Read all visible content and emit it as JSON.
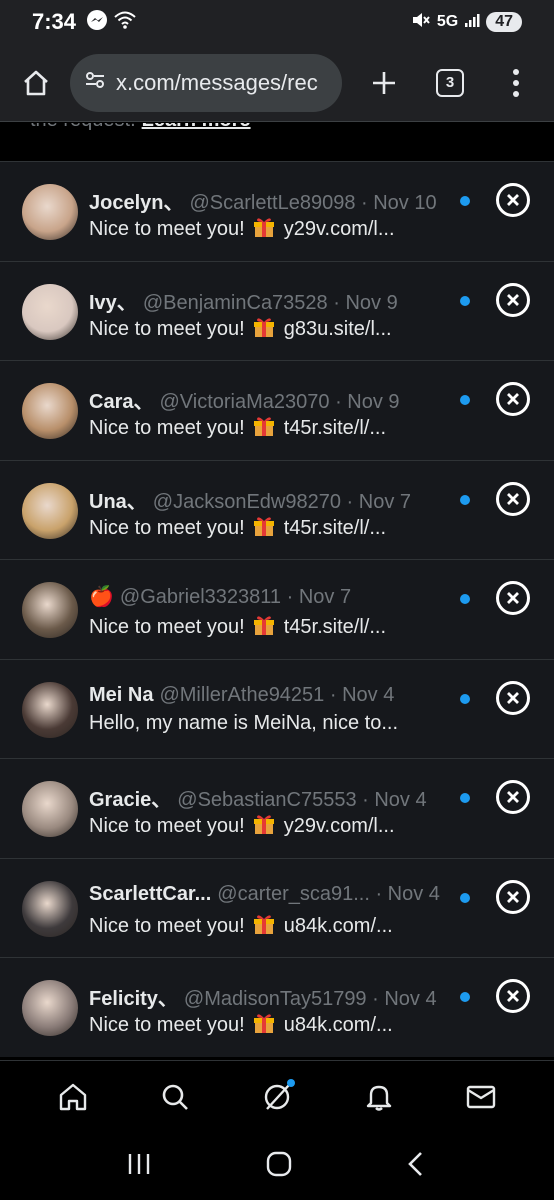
{
  "status_bar": {
    "time": "7:34",
    "network": "5G",
    "battery": "47"
  },
  "browser": {
    "url": "x.com/messages/rec",
    "tab_count": "3"
  },
  "notice": {
    "text": "the request.",
    "link": "Learn more"
  },
  "messages": [
    {
      "name": "Jocelyn、",
      "handle": "@ScarlettLe89098 · Nov 10",
      "preview": "Nice to meet you!",
      "link": "y29v.com/l...",
      "has_gift": true,
      "avatar_color": "#c8a48a"
    },
    {
      "name": "Ivy、",
      "handle": "@BenjaminCa73528 · Nov 9",
      "preview": "Nice to meet you!",
      "link": "g83u.site/l...",
      "has_gift": true,
      "avatar_color": "#d9c8c0"
    },
    {
      "name": "Cara、",
      "handle": "@VictoriaMa23070 · Nov 9",
      "preview": "Nice to meet you!",
      "link": "t45r.site/l/...",
      "has_gift": true,
      "avatar_color": "#b88f6a"
    },
    {
      "name": "Una、",
      "handle": "@JacksonEdw98270 · Nov 7",
      "preview": "Nice to meet you!",
      "link": "t45r.site/l/...",
      "has_gift": true,
      "avatar_color": "#c9a26b"
    },
    {
      "name": "🍎",
      "handle": "@Gabriel3323811 · Nov 7",
      "preview": "Nice to meet you!",
      "link": "t45r.site/l/...",
      "has_gift": true,
      "avatar_color": "#6b5a4a"
    },
    {
      "name": "Mei Na",
      "handle": "@MillerAthe94251 · Nov 4",
      "preview": "Hello, my name is MeiNa, nice to...",
      "link": "",
      "has_gift": false,
      "avatar_color": "#4a3a35"
    },
    {
      "name": "Gracie、",
      "handle": "@SebastianC75553 · Nov 4",
      "preview": "Nice to meet you!",
      "link": "y29v.com/l...",
      "has_gift": true,
      "avatar_color": "#9a8a80"
    },
    {
      "name": "ScarlettCar...",
      "handle": "@carter_sca91... · Nov 4",
      "preview": "Nice to meet you!",
      "link": "u84k.com/...",
      "has_gift": true,
      "avatar_color": "#3e3a3c"
    },
    {
      "name": "Felicity、",
      "handle": "@MadisonTay51799 · Nov 4",
      "preview": "Nice to meet you!",
      "link": "u84k.com/...",
      "has_gift": true,
      "avatar_color": "#8a7c78"
    }
  ],
  "colors": {
    "accent": "#1d9bf0",
    "row_bg": "#16181c",
    "muted_text": "#71767b"
  },
  "nav": {
    "items": [
      "home-icon",
      "search-icon",
      "grok-icon",
      "notifications-icon",
      "messages-icon"
    ]
  }
}
